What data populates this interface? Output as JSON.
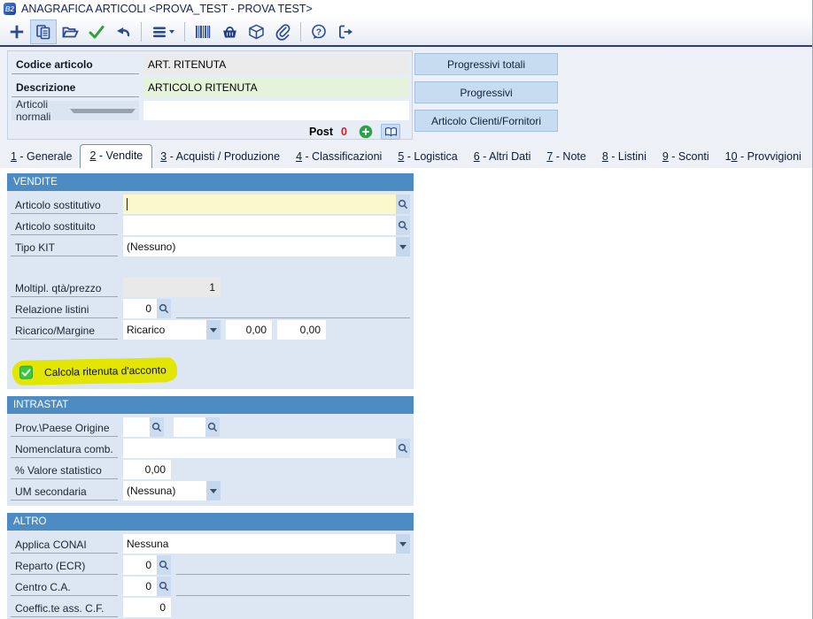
{
  "colors": {
    "accent_blue": "#4c8cc2",
    "toolbar_border": "#2c3e78",
    "panel_bg": "#dde7f3",
    "focus_field_bg": "#fbf9cb",
    "description_field_bg": "#e5f3da",
    "code_field_bg": "#ebebeb",
    "highlight_yellow": "#e3e602",
    "checkbox_green": "#3cc83c",
    "post_count_red": "#d21c2e"
  },
  "window": {
    "app_badge": "B2",
    "title": "ANAGRAFICA ARTICOLI <PROVA_TEST - PROVA TEST>"
  },
  "toolbar": {
    "icons": [
      "add",
      "copy",
      "open-folder",
      "confirm",
      "undo",
      "menu",
      "barcode",
      "basket",
      "package",
      "attachment",
      "help",
      "exit"
    ],
    "active_icon": "copy"
  },
  "header": {
    "codice_label": "Codice articolo",
    "codice_value": "ART. RITENUTA",
    "descrizione_label": "Descrizione",
    "descrizione_value": "ARTICOLO RITENUTA",
    "tipo_articolo_value": "Articoli normali",
    "descrizione2_value": "",
    "post_label": "Post",
    "post_count": "0"
  },
  "side_buttons": [
    {
      "label": "Progressivi totali"
    },
    {
      "label": "Progressivi"
    },
    {
      "label": "Articolo Clienti/Fornitori"
    }
  ],
  "tabs": [
    {
      "pre": "",
      "u": "1",
      "post": " - Generale",
      "active": false
    },
    {
      "pre": "",
      "u": "2",
      "post": " - Vendite",
      "active": true
    },
    {
      "pre": "",
      "u": "3",
      "post": " - Acquisti / Produzione",
      "active": false
    },
    {
      "pre": "",
      "u": "4",
      "post": " - Classificazioni",
      "active": false
    },
    {
      "pre": "",
      "u": "5",
      "post": " - Logistica",
      "active": false
    },
    {
      "pre": "",
      "u": "6",
      "post": " - Altri Dati",
      "active": false
    },
    {
      "pre": "",
      "u": "7",
      "post": " - Note",
      "active": false
    },
    {
      "pre": "",
      "u": "8",
      "post": " - Listini",
      "active": false
    },
    {
      "pre": "",
      "u": "9",
      "post": " - Sconti",
      "active": false
    },
    {
      "pre": "1",
      "u": "0",
      "post": " - Provvigioni",
      "active": false
    }
  ],
  "sections": {
    "vendite": {
      "title": "VENDITE",
      "articolo_sostitutivo_label": "Articolo sostitutivo",
      "articolo_sostitutivo_value": "",
      "articolo_sostituito_label": "Articolo sostituito",
      "articolo_sostituito_value": "",
      "tipo_kit_label": "Tipo KIT",
      "tipo_kit_value": "(Nessuno)",
      "moltipl_label": "Moltipl. qtà/prezzo",
      "moltipl_value": "1",
      "relazione_label": "Relazione listini",
      "relazione_value": "0",
      "ricarico_label": "Ricarico/Margine",
      "ricarico_select_value": "Ricarico",
      "ricarico_value1": "0,00",
      "ricarico_value2": "0,00",
      "checkbox_label": "Calcola ritenuta d'acconto",
      "checkbox_checked": true
    },
    "intrastat": {
      "title": "INTRASTAT",
      "prov_paese_label": "Prov.\\Paese Origine",
      "prov_value": "",
      "paese_value": "",
      "nomenclatura_label": "Nomenclatura comb.",
      "nomenclatura_value": "",
      "valore_statistico_label": "% Valore statistico",
      "valore_statistico_value": "0,00",
      "um_secondaria_label": "UM secondaria",
      "um_secondaria_value": "(Nessuna)"
    },
    "altro": {
      "title": "ALTRO",
      "applica_conai_label": "Applica CONAI",
      "applica_conai_value": "Nessuna",
      "reparto_label": "Reparto (ECR)",
      "reparto_value": "0",
      "centro_label": "Centro C.A.",
      "centro_value": "0",
      "coefficiente_label": "Coeffic.te ass. C.F.",
      "coefficiente_value": "0"
    }
  }
}
